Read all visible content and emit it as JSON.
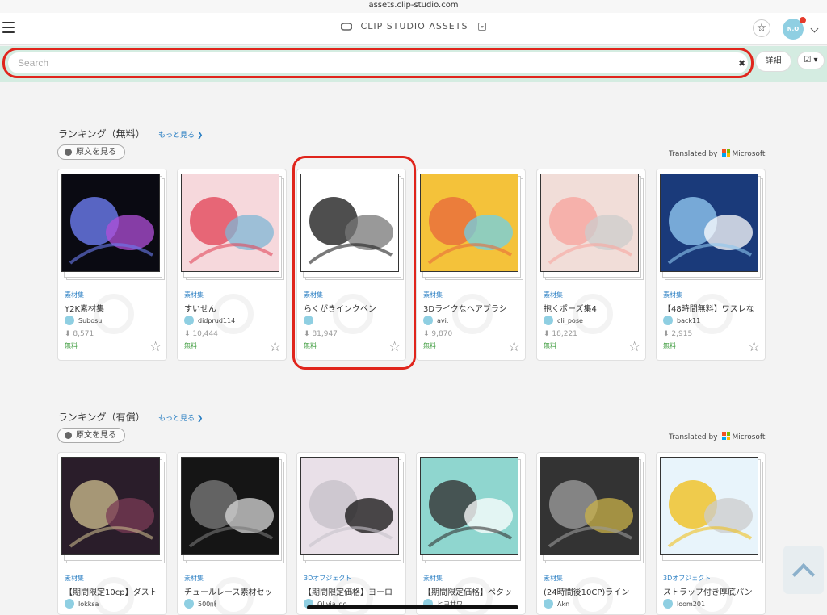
{
  "browser": {
    "url": "assets.clip-studio.com"
  },
  "header": {
    "brand": "CLIP STUDIO ASSETS",
    "avatar_text": "N.O\nmaps"
  },
  "search": {
    "placeholder": "Search",
    "clear": "✖",
    "detail_label": "詳細",
    "filter_label": "☑ ▾"
  },
  "sections": [
    {
      "title": "ランキング（無料）",
      "more": "もっと見る ❯",
      "orig_label": "原文を見る",
      "translated": "Translated by",
      "ms": "Microsoft",
      "cards": [
        {
          "cat": "素材集",
          "title": "Y2K素材集",
          "author": "Subosu",
          "dl": "⬇ 8,571",
          "price": "無料",
          "colors": [
            "#0a0a12",
            "#6b7cf0",
            "#b04fd8"
          ]
        },
        {
          "cat": "素材集",
          "title": "すいせん",
          "author": "didprud114",
          "dl": "⬇ 10,444",
          "price": "無料",
          "colors": [
            "#f6d8dc",
            "#e34a5c",
            "#7fb7d6"
          ]
        },
        {
          "cat": "素材集",
          "title": "らくがきインクペン",
          "author": "",
          "dl": "⬇ 81,947",
          "price": "無料",
          "colors": [
            "#ffffff",
            "#222222",
            "#777777"
          ]
        },
        {
          "cat": "素材集",
          "title": "3Dライクなヘアブラシ",
          "author": "avi.",
          "dl": "⬇ 9,870",
          "price": "無料",
          "colors": [
            "#f4c23a",
            "#e86b3c",
            "#6fd0e8"
          ]
        },
        {
          "cat": "素材集",
          "title": "抱くポーズ集4",
          "author": "cli_pose",
          "dl": "⬇ 18,221",
          "price": "無料",
          "colors": [
            "#f1ddd8",
            "#f8a6a0",
            "#cccccc"
          ]
        },
        {
          "cat": "素材集",
          "title": "【48時間無料】ワスレな",
          "author": "back11",
          "dl": "⬇ 2,915",
          "price": "無料",
          "colors": [
            "#1a3a7a",
            "#8ec6ef",
            "#ffffff"
          ]
        }
      ]
    },
    {
      "title": "ランキング（有償）",
      "more": "もっと見る ❯",
      "orig_label": "原文を見る",
      "translated": "Translated by",
      "ms": "Microsoft",
      "cards": [
        {
          "cat": "素材集",
          "title": "【期間限定10cp】ダスト",
          "author": "lokksa",
          "colors": [
            "#2a1d2a",
            "#c6b68a",
            "#7a3b55"
          ]
        },
        {
          "cat": "素材集",
          "title": "チュールレース素材セッ",
          "author": "500㎖",
          "colors": [
            "#151515",
            "#777777",
            "#d8d8d8"
          ]
        },
        {
          "cat": "3Dオブジェクト",
          "title": "【期間限定価格】ヨーロ",
          "author": "Olivia_go",
          "colors": [
            "#e9e0e8",
            "#c7c2c9",
            "#111111"
          ]
        },
        {
          "cat": "素材集",
          "title": "【期間限定価格】ペタッ",
          "author": "ヒヨサワ",
          "colors": [
            "#8fd6cf",
            "#333333",
            "#ffffff"
          ]
        },
        {
          "cat": "素材集",
          "title": "(24時間後10CP)ライン",
          "author": "Akn",
          "colors": [
            "#333333",
            "#999999",
            "#c9b14a"
          ]
        },
        {
          "cat": "3Dオブジェクト",
          "title": "ストラップ付き厚底パン",
          "author": "loom201",
          "colors": [
            "#e8f4fb",
            "#f0c020",
            "#cccccc"
          ]
        }
      ]
    }
  ]
}
